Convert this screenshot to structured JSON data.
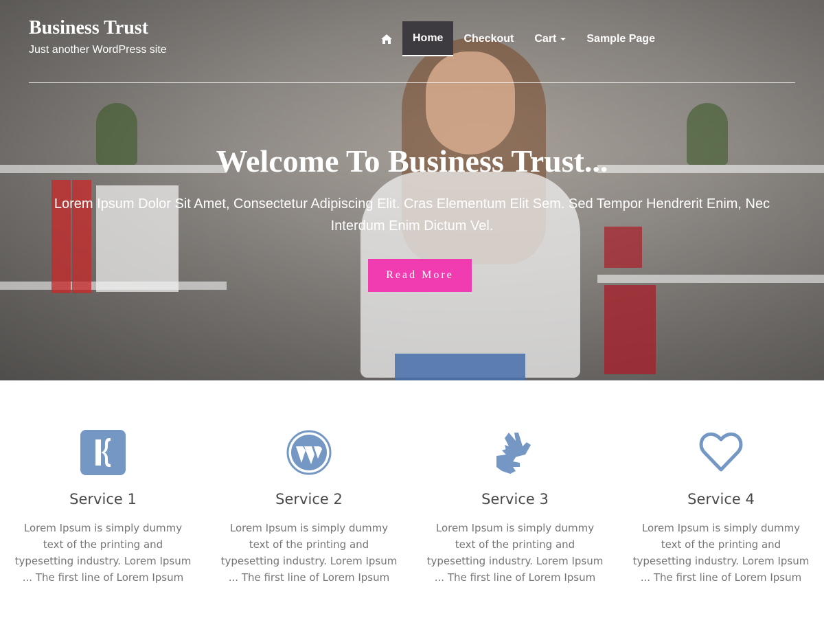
{
  "site": {
    "title": "Business Trust",
    "tagline": "Just another WordPress site"
  },
  "nav": {
    "home_icon": "home-icon",
    "items": [
      {
        "label": "Home",
        "active": true
      },
      {
        "label": "Checkout"
      },
      {
        "label": "Cart",
        "has_dropdown": true
      },
      {
        "label": "Sample Page"
      }
    ]
  },
  "hero": {
    "title": "Welcome To Business Trust...",
    "subtitle": "Lorem Ipsum Dolor Sit Amet, Consectetur Adipiscing Elit. Cras Elementum Elit Sem. Sed Tempor Hendrerit Enim, Nec Interdum Enim Dictum Vel.",
    "button_label": "Read More",
    "button_color": "#f13bb1"
  },
  "services": [
    {
      "icon": "kickstarter-icon",
      "title": "Service 1",
      "text": "Lorem Ipsum is simply dummy text of the printing and typesetting industry. Lorem Ipsum ... The first line of Lorem Ipsum"
    },
    {
      "icon": "wordpress-icon",
      "title": "Service 2",
      "text": "Lorem Ipsum is simply dummy text of the printing and typesetting industry. Lorem Ipsum ... The first line of Lorem Ipsum"
    },
    {
      "icon": "sign-language-icon",
      "title": "Service 3",
      "text": "Lorem Ipsum is simply dummy text of the printing and typesetting industry. Lorem Ipsum ... The first line of Lorem Ipsum"
    },
    {
      "icon": "heart-icon",
      "title": "Service 4",
      "text": "Lorem Ipsum is simply dummy text of the printing and typesetting industry. Lorem Ipsum ... The first line of Lorem Ipsum"
    }
  ],
  "colors": {
    "icon": "#7597c4",
    "accent": "#f13bb1",
    "nav_active_bg": "#3d3b40"
  }
}
